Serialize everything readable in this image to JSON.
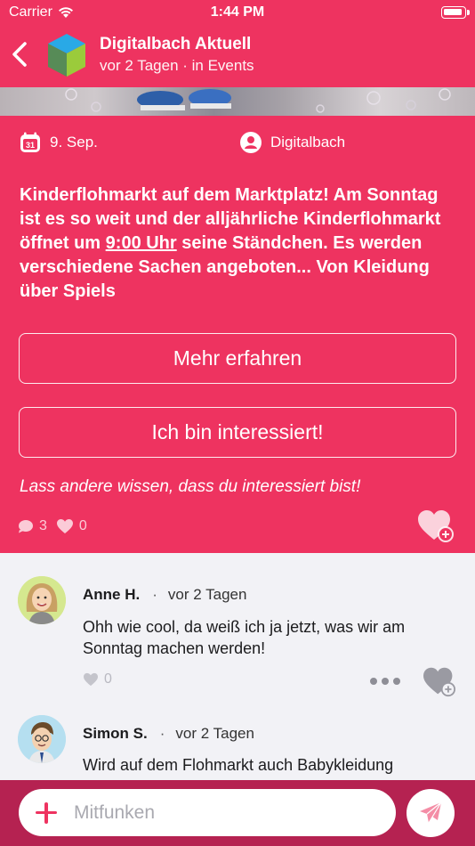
{
  "status_bar": {
    "carrier": "Carrier",
    "time": "1:44 PM"
  },
  "nav": {
    "title": "Digitalbach Aktuell",
    "subtitle": "vor 2 Tagen · in Events"
  },
  "post": {
    "date": "9. Sep.",
    "calendar_day": "31",
    "author": "Digitalbach",
    "text_before": "Kinderflohmarkt auf dem Marktplatz! Am Sonntag ist es so weit und der alljährliche Kinderflohmarkt öffnet um ",
    "text_time": "9:00 Uhr",
    "text_after": " seine Ständchen. Es werden verschiedene Sachen angeboten... Von Kleidung über Spiels",
    "more_label": "Mehr erfahren",
    "interested_label": "Ich bin interessiert!",
    "hint": "Lass andere wissen, dass du interessiert bist!",
    "comment_count": "3",
    "like_count": "0"
  },
  "comments": [
    {
      "name": "Anne H.",
      "separator": "·",
      "when": "vor 2 Tagen",
      "body": "Ohh wie cool, da weiß ich ja jetzt, was wir am Sonntag machen werden!",
      "likes": "0"
    },
    {
      "name": "Simon S.",
      "separator": "·",
      "when": "vor 2 Tagen",
      "body": "Wird auf dem Flohmarkt auch Babykleidung"
    }
  ],
  "compose": {
    "placeholder": "Mitfunken"
  },
  "colors": {
    "primary": "#ee3360",
    "compose_bar": "#b52251",
    "background": "#f2f2f6"
  }
}
